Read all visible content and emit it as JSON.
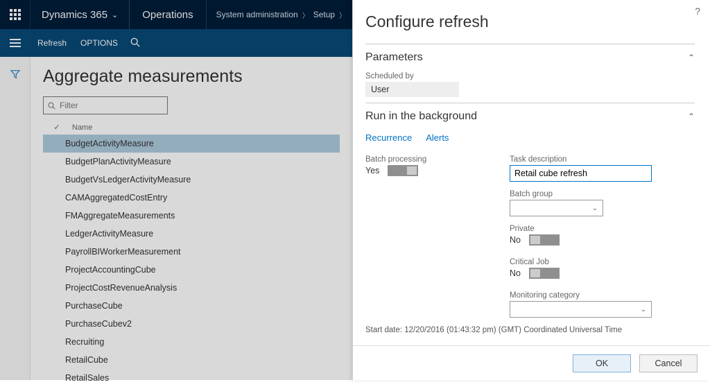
{
  "topbar": {
    "brand": "Dynamics 365",
    "module": "Operations",
    "crumb1": "System administration",
    "crumb2": "Setup"
  },
  "actionbar": {
    "refresh": "Refresh",
    "options": "OPTIONS"
  },
  "main": {
    "title": "Aggregate measurements",
    "filter_placeholder": "Filter",
    "name_header": "Name",
    "items": [
      "BudgetActivityMeasure",
      "BudgetPlanActivityMeasure",
      "BudgetVsLedgerActivityMeasure",
      "CAMAggregatedCostEntry",
      "FMAggregateMeasurements",
      "LedgerActivityMeasure",
      "PayrollBIWorkerMeasurement",
      "ProjectAccountingCube",
      "ProjectCostRevenueAnalysis",
      "PurchaseCube",
      "PurchaseCubev2",
      "Recruiting",
      "RetailCube",
      "RetailSales"
    ],
    "selected_index": 0
  },
  "pane": {
    "title": "Configure refresh",
    "parameters": {
      "header": "Parameters",
      "scheduled_by_label": "Scheduled by",
      "scheduled_by_value": "User"
    },
    "background": {
      "header": "Run in the background",
      "tab_recurrence": "Recurrence",
      "tab_alerts": "Alerts",
      "batch_processing_label": "Batch processing",
      "batch_processing_value": "Yes",
      "task_desc_label": "Task description",
      "task_desc_value": "Retail cube refresh",
      "batch_group_label": "Batch group",
      "batch_group_value": "",
      "private_label": "Private",
      "private_value": "No",
      "critical_label": "Critical Job",
      "critical_value": "No",
      "monitoring_label": "Monitoring category",
      "monitoring_value": "",
      "start_date_line": "Start date: 12/20/2016 (01:43:32 pm) (GMT) Coordinated Universal Time"
    },
    "buttons": {
      "ok": "OK",
      "cancel": "Cancel"
    }
  }
}
